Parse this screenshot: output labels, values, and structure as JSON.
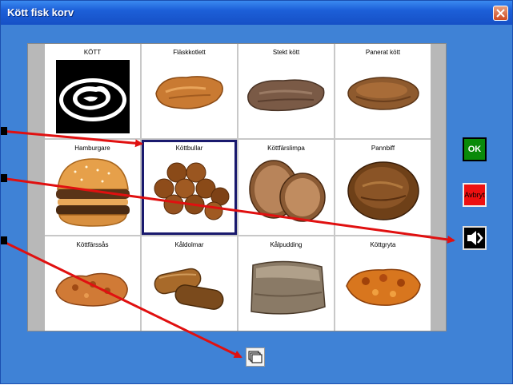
{
  "window": {
    "title": "Kött fisk korv"
  },
  "grid": {
    "items": [
      {
        "label": "KÖTT",
        "icon": "meat-category-symbol"
      },
      {
        "label": "Fläskkotlett",
        "icon": "pork-chop-image"
      },
      {
        "label": "Stekt kött",
        "icon": "fried-meat-image"
      },
      {
        "label": "Panerat kött",
        "icon": "breaded-meat-image"
      },
      {
        "label": "Hamburgare",
        "icon": "hamburger-image"
      },
      {
        "label": "Köttbullar",
        "icon": "meatballs-image",
        "selected": true
      },
      {
        "label": "Köttfärslimpa",
        "icon": "meatloaf-image"
      },
      {
        "label": "Pannbiff",
        "icon": "pan-steak-image"
      },
      {
        "label": "Köttfärssås",
        "icon": "meat-sauce-image"
      },
      {
        "label": "Kåldolmar",
        "icon": "cabbage-rolls-image"
      },
      {
        "label": "Kålpudding",
        "icon": "cabbage-pudding-image"
      },
      {
        "label": "Köttgryta",
        "icon": "meat-stew-image"
      }
    ]
  },
  "buttons": {
    "ok_label": "OK",
    "cancel_label": "Avbryt",
    "speaker_icon": "speaker-icon",
    "pages_icon": "pages-icon"
  },
  "colors": {
    "ok": "#0a8a0a",
    "cancel": "#ee1010",
    "annotation_arrow": "#e01010"
  }
}
